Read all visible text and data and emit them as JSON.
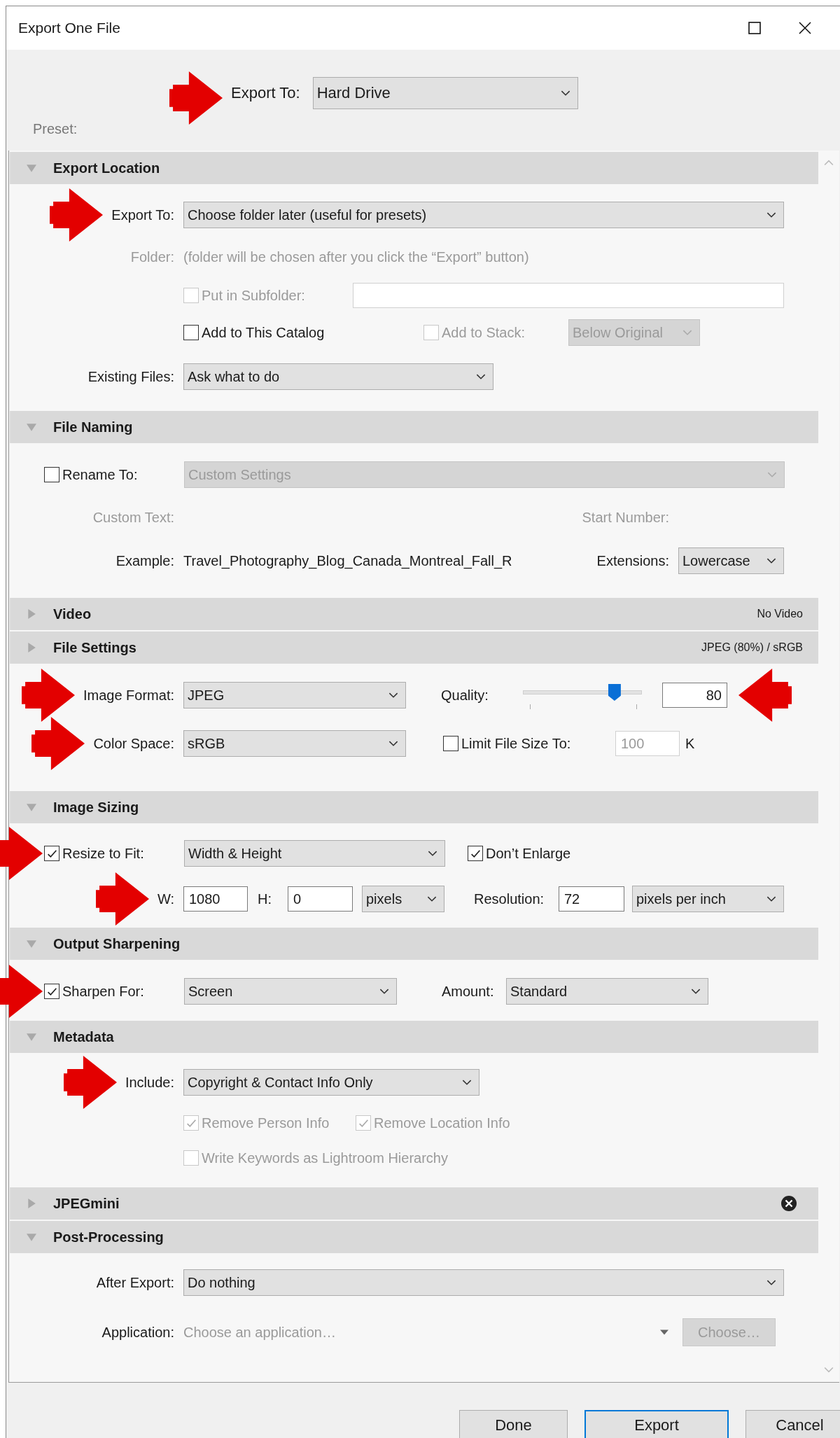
{
  "window": {
    "title": "Export One File"
  },
  "export_to": {
    "label": "Export To:",
    "value": "Hard Drive",
    "arrow": true
  },
  "preset": {
    "label": "Preset:"
  },
  "sections": [
    {
      "kind": "export_location",
      "title": "Export Location",
      "expanded": true,
      "export_to": {
        "label": "Export To:",
        "value": "Choose folder later (useful for presets)",
        "arrow": true
      },
      "folder": {
        "label": "Folder:",
        "value": "(folder will be chosen after you click the “Export” button)",
        "disabled": true
      },
      "subfolder": {
        "label": "Put in Subfolder:",
        "checked": false,
        "disabled": true
      },
      "add_to_catalog": {
        "label": "Add to This Catalog",
        "checked": false,
        "disabled": false
      },
      "add_to_stack": {
        "label": "Add to Stack:",
        "checked": false,
        "disabled": true,
        "value": "Below Original"
      },
      "existing_files": {
        "label": "Existing Files:",
        "value": "Ask what to do"
      }
    },
    {
      "kind": "file_naming",
      "title": "File Naming",
      "expanded": true,
      "rename_to": {
        "label": "Rename To:",
        "checked": false,
        "value": "Custom Settings"
      },
      "custom_text": {
        "label": "Custom Text:"
      },
      "start_number": {
        "label": "Start Number:"
      },
      "example": {
        "label": "Example:",
        "value": "Travel_Photography_Blog_Canada_Montreal_Fall_R"
      },
      "extensions": {
        "label": "Extensions:",
        "value": "Lowercase"
      }
    },
    {
      "kind": "video",
      "title": "Video",
      "expanded": false,
      "summary": "No Video"
    },
    {
      "kind": "file_settings",
      "title": "File Settings",
      "expanded": false,
      "summary": "JPEG (80%) / sRGB",
      "image_format": {
        "label": "Image Format:",
        "value": "JPEG",
        "arrow": true
      },
      "quality": {
        "label": "Quality:",
        "level": 0.77,
        "value": "80",
        "arrow": true
      },
      "color_space": {
        "label": "Color Space:",
        "value": "sRGB",
        "arrow": true
      },
      "limit_file_size": {
        "label": "Limit File Size To:",
        "checked": false,
        "value": "100",
        "unit": "K"
      }
    },
    {
      "kind": "image_sizing",
      "title": "Image Sizing",
      "expanded": true,
      "resize_to_fit": {
        "label": "Resize to Fit:",
        "checked": true,
        "value": "Width & Height",
        "arrow": true
      },
      "dont_enlarge": {
        "label": "Don’t Enlarge",
        "checked": true
      },
      "width": {
        "label": "W:",
        "value": "1080",
        "arrow": true
      },
      "height": {
        "label": "H:",
        "value": "0"
      },
      "units": {
        "value": "pixels"
      },
      "resolution": {
        "label": "Resolution:",
        "value": "72"
      },
      "resolution_units": {
        "value": "pixels per inch"
      }
    },
    {
      "kind": "output_sharpening",
      "title": "Output Sharpening",
      "expanded": true,
      "sharpen_for": {
        "label": "Sharpen For:",
        "checked": true,
        "value": "Screen",
        "arrow": true
      },
      "amount": {
        "label": "Amount:",
        "value": "Standard"
      }
    },
    {
      "kind": "metadata",
      "title": "Metadata",
      "expanded": true,
      "include": {
        "label": "Include:",
        "value": "Copyright & Contact Info Only",
        "arrow": true
      },
      "remove_person": {
        "label": "Remove Person Info",
        "checked": true,
        "disabled": true
      },
      "remove_location": {
        "label": "Remove Location Info",
        "checked": true,
        "disabled": true
      },
      "write_keywords": {
        "label": "Write Keywords as Lightroom Hierarchy",
        "checked": false,
        "disabled": true
      }
    },
    {
      "kind": "jpegmini",
      "title": "JPEGmini",
      "expanded": false,
      "close_icon": true
    },
    {
      "kind": "post_processing",
      "title": "Post-Processing",
      "expanded": true,
      "after_export": {
        "label": "After Export:",
        "value": "Do nothing"
      },
      "application": {
        "label": "Application:",
        "placeholder": "Choose an application…",
        "button": "Choose…",
        "disabled": true
      }
    }
  ],
  "buttons": [
    {
      "label": "Done",
      "selected": false
    },
    {
      "label": "Export",
      "selected": true
    },
    {
      "label": "Cancel",
      "selected": false
    }
  ]
}
